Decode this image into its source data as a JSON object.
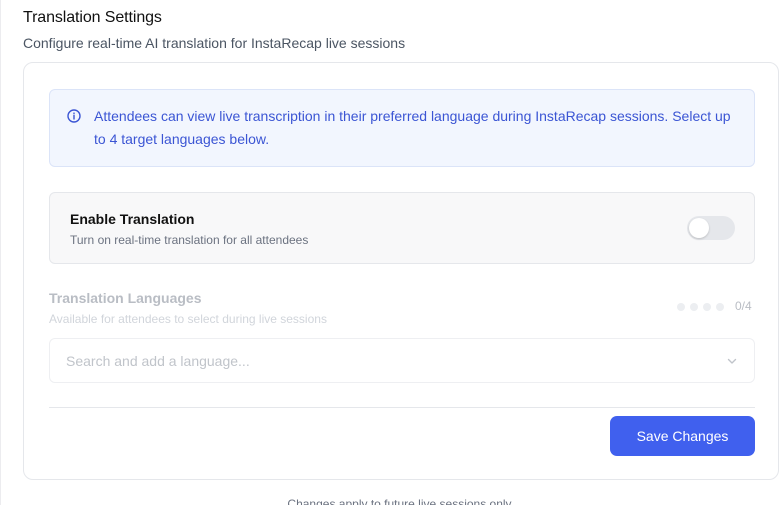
{
  "header": {
    "title": "Translation Settings",
    "subtitle": "Configure real-time AI translation for InstaRecap live sessions"
  },
  "info_banner": {
    "icon": "info-circle-icon",
    "text": "Attendees can view live transcription in their preferred language during InstaRecap sessions. Select up to 4 target languages below."
  },
  "translation_toggle": {
    "title": "Enable Translation",
    "description": "Turn on real-time translation for all attendees",
    "enabled": false
  },
  "languages": {
    "title": "Translation Languages",
    "description": "Available for attendees to select during live sessions",
    "selected_count": 0,
    "max_count": 4,
    "count_label": "0/4",
    "search_placeholder": "Search and add a language...",
    "dropdown_icon": "chevron-down-icon"
  },
  "actions": {
    "save_label": "Save Changes"
  },
  "footer": {
    "note": "Changes apply to future live sessions only"
  },
  "colors": {
    "accent": "#4060ee",
    "info_text": "#3b55d4",
    "info_bg": "#f2f6fe",
    "toggle_off": "#e5e7eb"
  }
}
